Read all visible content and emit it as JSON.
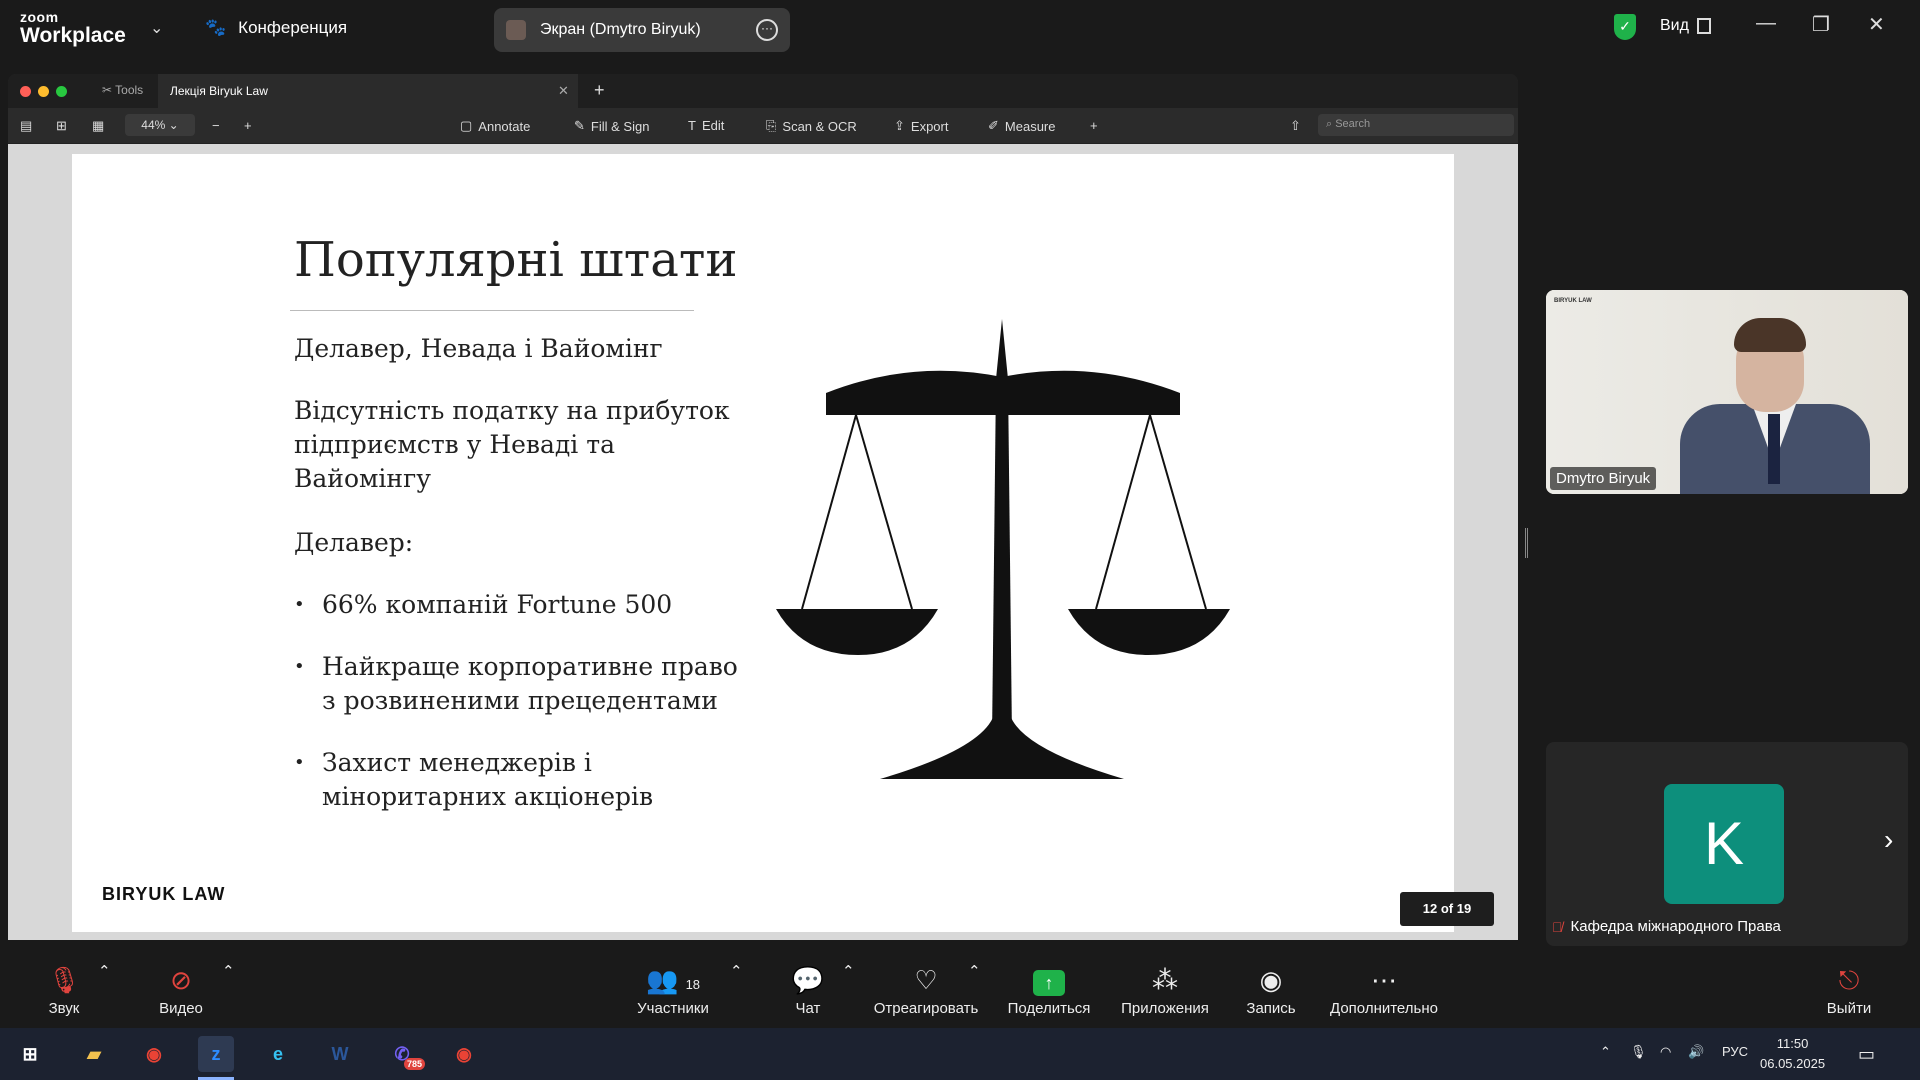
{
  "app": {
    "logo_top": "zoom",
    "logo_bottom": "Workplace",
    "meeting_label": "Конференция",
    "screen_share_label": "Экран (Dmytro Biryuk)",
    "view_label": "Вид"
  },
  "pdf": {
    "tabs": [
      {
        "label": "Tools"
      },
      {
        "label": "Лекція Biryuk Law"
      }
    ],
    "zoom": "44%",
    "tools": [
      {
        "label": "Annotate"
      },
      {
        "label": "Fill & Sign"
      },
      {
        "label": "Edit"
      },
      {
        "label": "Scan & OCR"
      },
      {
        "label": "Export"
      },
      {
        "label": "Measure"
      }
    ],
    "search_placeholder": "Search",
    "page_indicator": "12 of 19"
  },
  "slide": {
    "title": "Популярні штати",
    "line1": "Делавер, Невада і Вайомінг",
    "para2": [
      "Відсутність податку на прибуток",
      "підприємств у Неваді та",
      "Вайомінгу"
    ],
    "line3": "Делавер:",
    "bullets": [
      [
        "66% компаній Fortune 500"
      ],
      [
        "Найкраще корпоративне право",
        "з розвиненими прецедентами"
      ],
      [
        "Захист менеджерів і",
        "міноритарних акціонерів"
      ]
    ],
    "brand": "BIRYUK LAW"
  },
  "participants": {
    "video_name": "Dmytro Biryuk",
    "video_watermark": "BIRYUK LAW",
    "avatar_letter": "K",
    "avatar_name": "Кафедра міжнародного Права",
    "avatar_color": "#0d8f7c"
  },
  "zoombar": {
    "audio": "Звук",
    "video": "Видео",
    "participants": "Участники",
    "participants_count": "18",
    "chat": "Чат",
    "react": "Отреагировать",
    "share": "Поделиться",
    "apps": "Приложения",
    "record": "Запись",
    "more": "Дополнительно",
    "leave": "Выйти"
  },
  "taskbar": {
    "viber_badge": "785",
    "lang": "РУС",
    "time": "11:50",
    "date": "06.05.2025"
  }
}
